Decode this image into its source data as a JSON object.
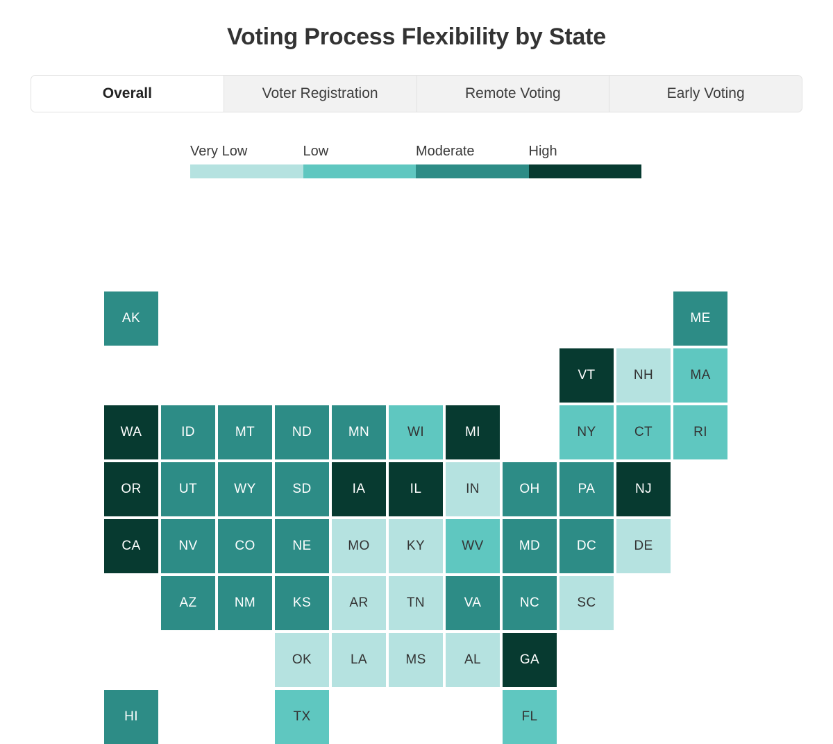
{
  "header": {
    "title": "Voting Process Flexibility by State"
  },
  "tabs": [
    {
      "label": "Overall",
      "active": true
    },
    {
      "label": "Voter Registration",
      "active": false
    },
    {
      "label": "Remote Voting",
      "active": false
    },
    {
      "label": "Early Voting",
      "active": false
    }
  ],
  "legend": {
    "labels": [
      "Very Low",
      "Low",
      "Moderate",
      "High"
    ],
    "colors": [
      "#b5e2e0",
      "#5fc7c0",
      "#2d8c86",
      "#073a30"
    ]
  },
  "palette": {
    "very_low": "#b5e2e0",
    "low": "#5fc7c0",
    "moderate": "#2d8c86",
    "high": "#073a30",
    "text_on_light": "#333333",
    "text_on_dark": "#ffffff",
    "background": "#ffffff"
  },
  "chart_data": {
    "type": "heatmap",
    "title": "Voting Process Flexibility by State",
    "subtitle": "",
    "xlabel": "",
    "ylabel": "",
    "legend_position": "top",
    "grid": false,
    "categories": [
      "Very Low",
      "Low",
      "Moderate",
      "High"
    ],
    "category_colors": [
      "#b5e2e0",
      "#5fc7c0",
      "#2d8c86",
      "#073a30"
    ],
    "metric": "Overall",
    "layout": "tile-cartogram",
    "grid_columns": 11,
    "grid_rows": 8,
    "cells": [
      {
        "state": "AK",
        "category": "Moderate",
        "col": 0,
        "row": 0
      },
      {
        "state": "ME",
        "category": "Moderate",
        "col": 10,
        "row": 0
      },
      {
        "state": "VT",
        "category": "High",
        "col": 8,
        "row": 1
      },
      {
        "state": "NH",
        "category": "Very Low",
        "col": 9,
        "row": 1
      },
      {
        "state": "MA",
        "category": "Low",
        "col": 10,
        "row": 1
      },
      {
        "state": "WA",
        "category": "High",
        "col": 0,
        "row": 2
      },
      {
        "state": "ID",
        "category": "Moderate",
        "col": 1,
        "row": 2
      },
      {
        "state": "MT",
        "category": "Moderate",
        "col": 2,
        "row": 2
      },
      {
        "state": "ND",
        "category": "Moderate",
        "col": 3,
        "row": 2
      },
      {
        "state": "MN",
        "category": "Moderate",
        "col": 4,
        "row": 2
      },
      {
        "state": "WI",
        "category": "Low",
        "col": 5,
        "row": 2
      },
      {
        "state": "MI",
        "category": "High",
        "col": 6,
        "row": 2
      },
      {
        "state": "NY",
        "category": "Low",
        "col": 8,
        "row": 2
      },
      {
        "state": "CT",
        "category": "Low",
        "col": 9,
        "row": 2
      },
      {
        "state": "RI",
        "category": "Low",
        "col": 10,
        "row": 2
      },
      {
        "state": "OR",
        "category": "High",
        "col": 0,
        "row": 3
      },
      {
        "state": "UT",
        "category": "Moderate",
        "col": 1,
        "row": 3
      },
      {
        "state": "WY",
        "category": "Moderate",
        "col": 2,
        "row": 3
      },
      {
        "state": "SD",
        "category": "Moderate",
        "col": 3,
        "row": 3
      },
      {
        "state": "IA",
        "category": "High",
        "col": 4,
        "row": 3
      },
      {
        "state": "IL",
        "category": "High",
        "col": 5,
        "row": 3
      },
      {
        "state": "IN",
        "category": "Very Low",
        "col": 6,
        "row": 3
      },
      {
        "state": "OH",
        "category": "Moderate",
        "col": 7,
        "row": 3
      },
      {
        "state": "PA",
        "category": "Moderate",
        "col": 8,
        "row": 3
      },
      {
        "state": "NJ",
        "category": "High",
        "col": 9,
        "row": 3
      },
      {
        "state": "CA",
        "category": "High",
        "col": 0,
        "row": 4
      },
      {
        "state": "NV",
        "category": "Moderate",
        "col": 1,
        "row": 4
      },
      {
        "state": "CO",
        "category": "Moderate",
        "col": 2,
        "row": 4
      },
      {
        "state": "NE",
        "category": "Moderate",
        "col": 3,
        "row": 4
      },
      {
        "state": "MO",
        "category": "Very Low",
        "col": 4,
        "row": 4
      },
      {
        "state": "KY",
        "category": "Very Low",
        "col": 5,
        "row": 4
      },
      {
        "state": "WV",
        "category": "Low",
        "col": 6,
        "row": 4
      },
      {
        "state": "MD",
        "category": "Moderate",
        "col": 7,
        "row": 4
      },
      {
        "state": "DC",
        "category": "Moderate",
        "col": 8,
        "row": 4
      },
      {
        "state": "DE",
        "category": "Very Low",
        "col": 9,
        "row": 4
      },
      {
        "state": "AZ",
        "category": "Moderate",
        "col": 1,
        "row": 5
      },
      {
        "state": "NM",
        "category": "Moderate",
        "col": 2,
        "row": 5
      },
      {
        "state": "KS",
        "category": "Moderate",
        "col": 3,
        "row": 5
      },
      {
        "state": "AR",
        "category": "Very Low",
        "col": 4,
        "row": 5
      },
      {
        "state": "TN",
        "category": "Very Low",
        "col": 5,
        "row": 5
      },
      {
        "state": "VA",
        "category": "Moderate",
        "col": 6,
        "row": 5
      },
      {
        "state": "NC",
        "category": "Moderate",
        "col": 7,
        "row": 5
      },
      {
        "state": "SC",
        "category": "Very Low",
        "col": 8,
        "row": 5
      },
      {
        "state": "OK",
        "category": "Very Low",
        "col": 3,
        "row": 6
      },
      {
        "state": "LA",
        "category": "Very Low",
        "col": 4,
        "row": 6
      },
      {
        "state": "MS",
        "category": "Very Low",
        "col": 5,
        "row": 6
      },
      {
        "state": "AL",
        "category": "Very Low",
        "col": 6,
        "row": 6
      },
      {
        "state": "GA",
        "category": "High",
        "col": 7,
        "row": 6
      },
      {
        "state": "HI",
        "category": "Moderate",
        "col": 0,
        "row": 7
      },
      {
        "state": "TX",
        "category": "Low",
        "col": 3,
        "row": 7
      },
      {
        "state": "FL",
        "category": "Low",
        "col": 7,
        "row": 7
      }
    ]
  }
}
